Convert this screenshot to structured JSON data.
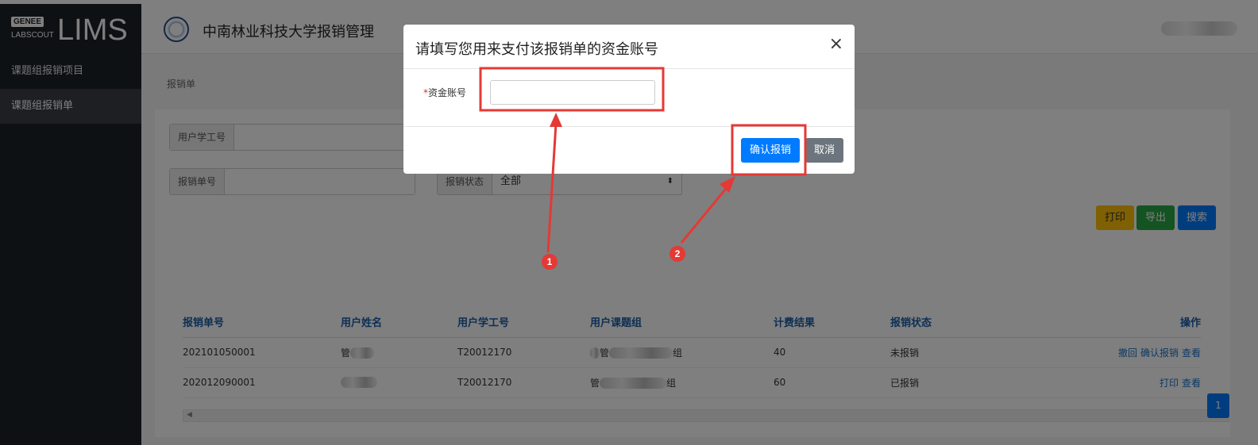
{
  "logo": {
    "badge": "GENEE",
    "sub": "LABSCOUT",
    "main": "LIMS"
  },
  "sidebar": {
    "items": [
      {
        "label": "课题组报销项目"
      },
      {
        "label": "课题组报销单"
      }
    ]
  },
  "header": {
    "title": "中南林业科技大学报销管理"
  },
  "breadcrumb": "报销单",
  "filters": {
    "user_id_label": "用户学工号",
    "user_id_value": "",
    "bill_no_label": "报销单号",
    "bill_no_value": "",
    "status_label": "报销状态",
    "status_value": "全部",
    "status_caret": "⬍"
  },
  "actions": {
    "print": "打印",
    "export": "导出",
    "search": "搜索"
  },
  "table": {
    "headers": [
      "报销单号",
      "用户姓名",
      "用户学工号",
      "用户课题组",
      "计费结果",
      "报销状态",
      "操作"
    ],
    "rows": [
      {
        "bill_no": "202101050001",
        "name_prefix": "管",
        "user_id": "T20012170",
        "group_prefix": "管",
        "group_suffix": "组",
        "fee": "40",
        "status": "未报销",
        "ops": [
          "撤回",
          "确认报销",
          "查看"
        ]
      },
      {
        "bill_no": "202012090001",
        "name_prefix": "",
        "user_id": "T20012170",
        "group_prefix": "管",
        "group_suffix": "组",
        "fee": "60",
        "status": "已报销",
        "ops": [
          "打印",
          "查看"
        ]
      }
    ]
  },
  "scrollbar": {
    "left_arrow": "◀",
    "right_arrow": "▶"
  },
  "pagination": {
    "current": "1"
  },
  "modal": {
    "title": "请填写您用来支付该报销单的资金账号",
    "close": "×",
    "field_required_mark": "*",
    "field_label": "资金账号",
    "field_value": "",
    "confirm_label": "确认报销",
    "cancel_label": "取消"
  },
  "annotations": {
    "marker1": "1",
    "marker2": "2",
    "highlight_color": "#e53935"
  }
}
